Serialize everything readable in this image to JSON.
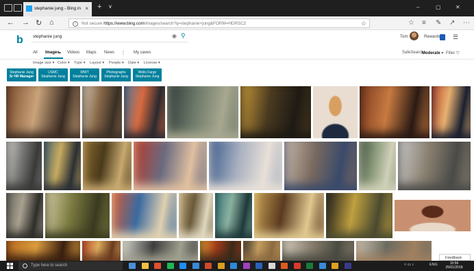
{
  "browser": {
    "tab_title": "stephanie jung - Bing in",
    "tab_close": "×",
    "new_tab": "+",
    "tab_menu": "∨",
    "minimize": "–",
    "maximize": "▢",
    "window_close": "✕",
    "address_prefix": "Not secure",
    "address_host": "https://www.bing.com",
    "address_path": "/images/search?q=stephanie+jung&FORM=HDRSC2"
  },
  "bing": {
    "logo": "b",
    "search_value": "stephanie jung",
    "user_name": "Tom",
    "rewards_label": "Rewards"
  },
  "scopes": {
    "all": "All",
    "images": "Images",
    "videos": "Videos",
    "maps": "Maps",
    "news": "News",
    "more": "⋮",
    "my_saves": "My saves"
  },
  "safesearch": {
    "label": "SafeSearch:",
    "value": "Moderate",
    "filter": "Filter"
  },
  "filters": [
    "Image size",
    "Color",
    "Type",
    "Layout",
    "People",
    "Date",
    "License"
  ],
  "chips": [
    {
      "line1": "Stephanie Jung",
      "line2": "Sr HR Manager"
    },
    {
      "line1": "USMC",
      "line2": "Stephanie Jung"
    },
    {
      "line1": "WWT",
      "line2": "Stephanie Jung"
    },
    {
      "line1": "Photographs",
      "line2": "Stephanie Jung"
    },
    {
      "line1": "Wells Fargo",
      "line2": "Stephanie Jung"
    }
  ],
  "images": [
    {
      "name": "result-image",
      "colors": [
        "#7a4a2a",
        "#c9a37a",
        "#3a2b22"
      ]
    },
    {
      "name": "result-image",
      "colors": [
        "#d9cdb8",
        "#8a6a4a",
        "#3a3026"
      ]
    },
    {
      "name": "result-image",
      "colors": [
        "#5a7ea0",
        "#d86a40",
        "#2a2a30"
      ]
    },
    {
      "name": "result-image",
      "colors": [
        "#2e3a38",
        "#6e7a6a",
        "#a8a890"
      ]
    },
    {
      "name": "result-image",
      "colors": [
        "#c89a3a",
        "#4a3a20",
        "#1e1a14"
      ]
    },
    {
      "name": "result-image-portrait",
      "colors": [
        "#e8ddd0",
        "#d8a060",
        "#1e2a40"
      ]
    },
    {
      "name": "result-image",
      "colors": [
        "#7a3a20",
        "#c87a40",
        "#2a1a14"
      ]
    },
    {
      "name": "result-image",
      "colors": [
        "#c04a2a",
        "#e6b070",
        "#1a2030"
      ]
    },
    {
      "name": "result-image",
      "colors": [
        "#d8d6d0",
        "#7a7a78",
        "#3a3a38"
      ]
    },
    {
      "name": "result-image",
      "colors": [
        "#4a6a70",
        "#c8aa60",
        "#2a3036"
      ]
    },
    {
      "name": "result-image",
      "colors": [
        "#8a6a30",
        "#4a3a1a",
        "#c8aa70"
      ]
    },
    {
      "name": "result-image",
      "colors": [
        "#b83a2a",
        "#6a6a80",
        "#e0c0a0"
      ]
    },
    {
      "name": "result-image",
      "colors": [
        "#3a5a8a",
        "#a8b0c0",
        "#e8e0d8"
      ]
    },
    {
      "name": "result-image",
      "colors": [
        "#c8b8a8",
        "#7a6a60",
        "#3a4a6a"
      ]
    },
    {
      "name": "result-image",
      "colors": [
        "#3a4a3a",
        "#8a9a7a",
        "#d0d0b8"
      ]
    },
    {
      "name": "result-image",
      "colors": [
        "#c8c8c8",
        "#8a8070",
        "#4a4a48"
      ]
    },
    {
      "name": "result-image",
      "colors": [
        "#6a6a60",
        "#a8a090",
        "#2e2e2a"
      ]
    },
    {
      "name": "result-image",
      "colors": [
        "#d8d0a8",
        "#7a7a40",
        "#3a3a20"
      ]
    },
    {
      "name": "result-image",
      "colors": [
        "#d85a30",
        "#3a6aa0",
        "#e0d0b0"
      ]
    },
    {
      "name": "result-image",
      "colors": [
        "#b8a070",
        "#6a5a3a",
        "#e0d8c0"
      ]
    },
    {
      "name": "result-image",
      "colors": [
        "#3a7a7a",
        "#8ab0a0",
        "#1e3a3a"
      ]
    },
    {
      "name": "result-image",
      "colors": [
        "#c8a050",
        "#5a3a20",
        "#e0c890"
      ]
    },
    {
      "name": "result-image",
      "colors": [
        "#1a1a1a",
        "#c0a040",
        "#4a4a30"
      ]
    },
    {
      "name": "result-image-portrait",
      "colors": [
        "#c89070",
        "#5a2a1a",
        "#e8d8c8"
      ]
    },
    {
      "name": "result-image",
      "colors": [
        "#b86a20",
        "#e0a040",
        "#3a2010"
      ]
    },
    {
      "name": "result-image",
      "colors": [
        "#c04a2a",
        "#e0b060",
        "#6a3a20"
      ]
    },
    {
      "name": "result-image",
      "colors": [
        "#d8d8d0",
        "#3a3a3a",
        "#a0a090"
      ]
    },
    {
      "name": "result-image",
      "colors": [
        "#e8a030",
        "#a03a1a",
        "#3a2a1a"
      ]
    },
    {
      "name": "result-image",
      "colors": [
        "#2a2a2a",
        "#c8a060",
        "#8a6a40"
      ]
    },
    {
      "name": "result-image",
      "colors": [
        "#d8d0c0",
        "#8a8070",
        "#4a4a40"
      ]
    },
    {
      "name": "result-image",
      "colors": [
        "#c8c0b0",
        "#6a6a60",
        "#a08060"
      ]
    }
  ],
  "feedback": "Feedback",
  "taskbar": {
    "search_placeholder": "Type here to search",
    "tray_lang": "ENG",
    "time": "10:56",
    "date": "25/01/2018",
    "icon_colors": [
      "#4a90d8",
      "#f0c040",
      "#e05030",
      "#1db954",
      "#1e90ff",
      "#3a8ad8",
      "#d04a2a",
      "#d8a020",
      "#2e8ad8",
      "#a040c0",
      "#2a62b8",
      "#d8d8d8",
      "#e05a20",
      "#d83a2a",
      "#1a7a3a",
      "#3a8ad8",
      "#e0a020",
      "#3a3a8a"
    ]
  }
}
